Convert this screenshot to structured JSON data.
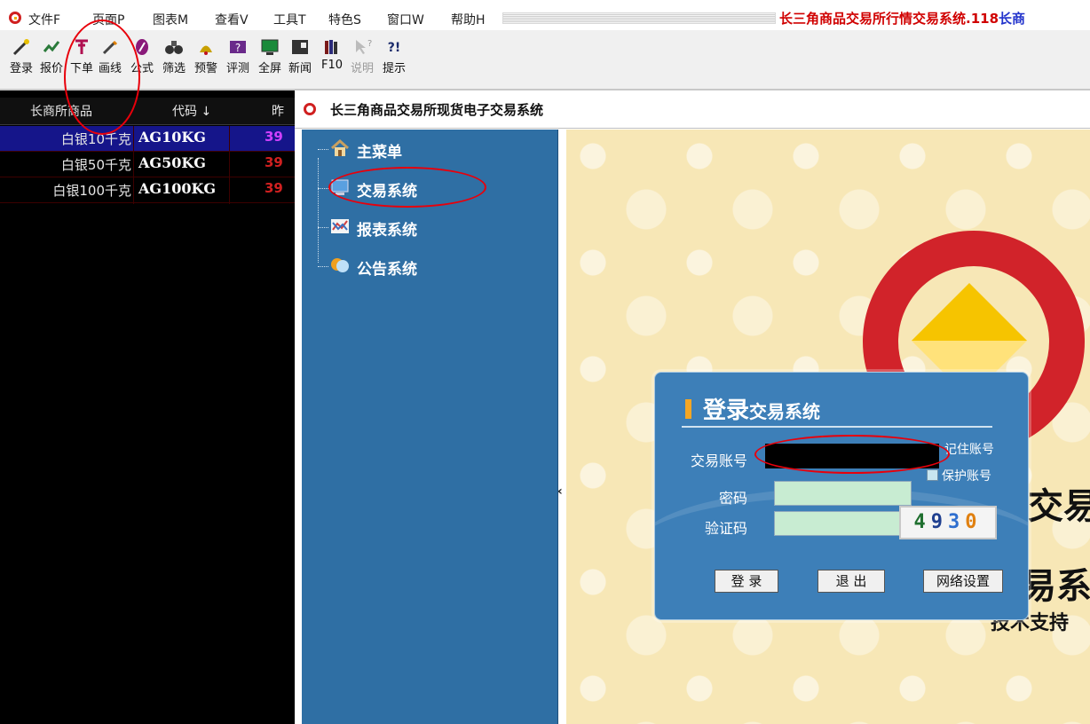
{
  "menu": {
    "items": [
      "文件F",
      "页面P",
      "图表M",
      "查看V",
      "工具T",
      "特色S",
      "窗口W",
      "帮助H"
    ],
    "app_title": "长三角商品交易所行情交易系统.118",
    "app_title_tail": "长商"
  },
  "toolbar": {
    "buttons": [
      {
        "label": "登录",
        "icon": "login-icon"
      },
      {
        "label": "报价",
        "icon": "quote-icon"
      },
      {
        "label": "下单",
        "icon": "order-icon"
      },
      {
        "label": "画线",
        "icon": "pencil-icon"
      },
      {
        "label": "公式",
        "icon": "formula-icon"
      },
      {
        "label": "筛选",
        "icon": "binoculars-icon"
      },
      {
        "label": "预警",
        "icon": "alarm-icon"
      },
      {
        "label": "评测",
        "icon": "evaluate-icon"
      },
      {
        "label": "全屏",
        "icon": "monitor-icon"
      },
      {
        "label": "新闻",
        "icon": "news-icon"
      },
      {
        "label": "F10",
        "icon": "books-icon"
      },
      {
        "label": "说明",
        "icon": "help-pointer-icon",
        "disabled": true
      },
      {
        "label": "提示",
        "icon": "tips-icon"
      }
    ]
  },
  "quotes": {
    "columns": [
      "长商所商品",
      "代码 ↓",
      "昨"
    ],
    "rows": [
      {
        "name": "白银10千克",
        "code": "AG10KG",
        "prev": "39",
        "selected": true
      },
      {
        "name": "白银50千克",
        "code": "AG50KG",
        "prev": "39",
        "selected": false
      },
      {
        "name": "白银100千克",
        "code": "AG100KG",
        "prev": "39",
        "selected": false
      }
    ]
  },
  "subwindow": {
    "title": "长三角商品交易所现货电子交易系统",
    "tree": [
      "主菜单",
      "交易系统",
      "报表系统",
      "公告系统"
    ],
    "collapse_glyph": "‹"
  },
  "banner": {
    "text_1": "交易",
    "text_2": "易系",
    "support": "技术支持"
  },
  "login": {
    "title_big": "登录",
    "title_small": "交易系统",
    "account_label": "交易账号",
    "remember_label": "记住账号",
    "protect_label": "保护账号",
    "password_label": "密码",
    "captcha_label": "验证码",
    "captcha": [
      "4",
      "9",
      "3",
      "0"
    ],
    "login_button": "登 录",
    "exit_button": "退 出",
    "network_button": "网络设置"
  },
  "colors": {
    "annotation": "#e8000b",
    "nav_bg": "#2f6fa4",
    "login_bg": "#3d7fb8",
    "title_red": "#d00000"
  }
}
